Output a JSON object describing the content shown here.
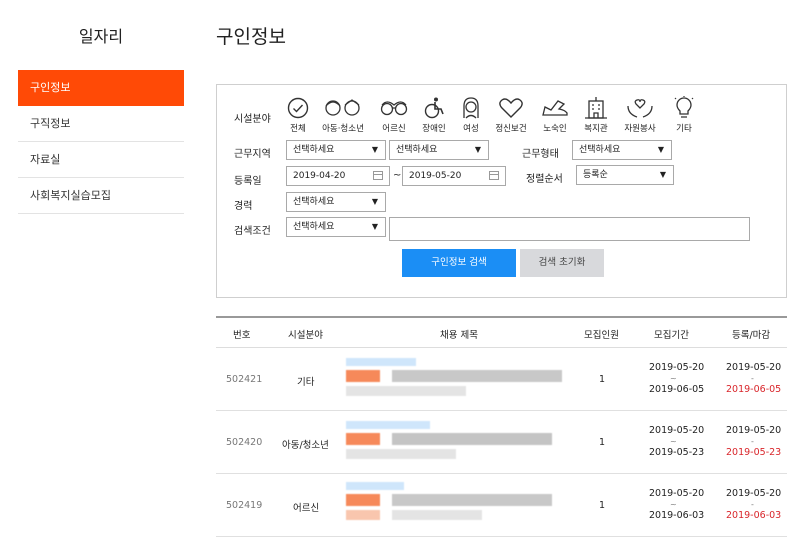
{
  "sidebar": {
    "title": "일자리",
    "items": [
      {
        "label": "구인정보",
        "active": true
      },
      {
        "label": "구직정보"
      },
      {
        "label": "자료실"
      },
      {
        "label": "사회복지실습모집"
      }
    ]
  },
  "page_title": "구인정보",
  "search": {
    "category_label": "시설분야",
    "categories": [
      "전체",
      "아동·청소년",
      "어르신",
      "장애인",
      "여성",
      "정신보건",
      "노숙인",
      "복지관",
      "자원봉사",
      "기타"
    ],
    "region_label": "근무지역",
    "region1": "선택하세요",
    "region2": "선택하세요",
    "worktype_label": "근무형태",
    "worktype": "선택하세요",
    "date_label": "등록일",
    "date_from": "2019-04-20",
    "date_to": "2019-05-20",
    "date_sep": "~",
    "sort_label": "정렬순서",
    "sort": "등록순",
    "career_label": "경력",
    "career": "선택하세요",
    "condition_label": "검색조건",
    "condition": "선택하세요",
    "keyword": "",
    "search_button": "구인정보 검색",
    "reset_button": "검색 초기화"
  },
  "table": {
    "headers": [
      "번호",
      "시설분야",
      "채용 제목",
      "모집인원",
      "모집기간",
      "등록/마감"
    ],
    "rows": [
      {
        "no": "502421",
        "field": "기타",
        "count": "1",
        "period_start": "2019-05-20",
        "period_sep": "~",
        "period_end": "2019-06-05",
        "reg": "2019-05-20",
        "reg_sep": "-",
        "deadline": "2019-06-05"
      },
      {
        "no": "502420",
        "field": "아동/청소년",
        "count": "1",
        "period_start": "2019-05-20",
        "period_sep": "~",
        "period_end": "2019-05-23",
        "reg": "2019-05-20",
        "reg_sep": "-",
        "deadline": "2019-05-23"
      },
      {
        "no": "502419",
        "field": "어르신",
        "count": "1",
        "period_start": "2019-05-20",
        "period_sep": "~",
        "period_end": "2019-06-03",
        "reg": "2019-05-20",
        "reg_sep": "-",
        "deadline": "2019-06-03"
      }
    ]
  },
  "colors": {
    "accent": "#ff4a06",
    "primary": "#1b8ef5",
    "deadline": "#d9262b"
  }
}
